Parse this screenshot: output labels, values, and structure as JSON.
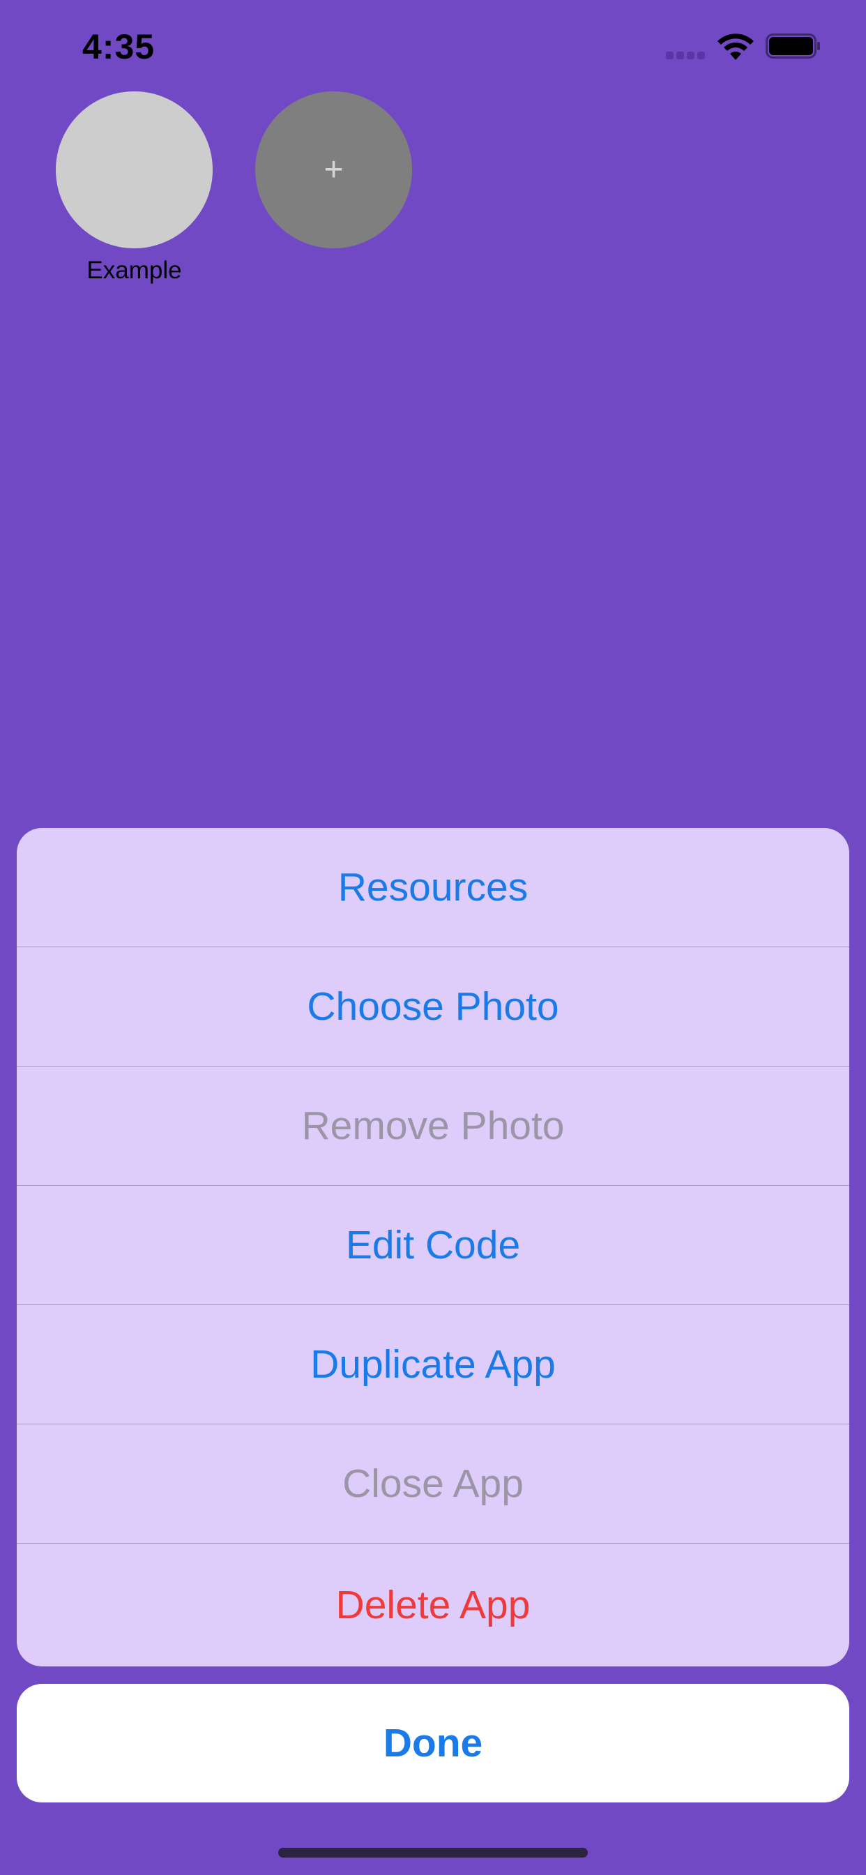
{
  "status_bar": {
    "time": "4:35",
    "icons": [
      "cellular-signal-icon",
      "wifi-icon",
      "battery-icon"
    ]
  },
  "apps": [
    {
      "label": "Example",
      "icon": "app-placeholder",
      "color": "#cdcdcd"
    },
    {
      "label": "+",
      "icon": "plus-icon",
      "color": "#7f7f7f"
    }
  ],
  "action_sheet": {
    "items": [
      {
        "label": "Resources",
        "state": "enabled"
      },
      {
        "label": "Choose Photo",
        "state": "enabled"
      },
      {
        "label": "Remove Photo",
        "state": "disabled"
      },
      {
        "label": "Edit Code",
        "state": "enabled"
      },
      {
        "label": "Duplicate App",
        "state": "enabled"
      },
      {
        "label": "Close App",
        "state": "disabled"
      },
      {
        "label": "Delete App",
        "state": "destructive"
      }
    ],
    "cancel_label": "Done"
  },
  "colors": {
    "background": "#7249c5",
    "sheet_background": "#decdfb",
    "action_blue": "#1a7ae8",
    "disabled_gray": "#9b95a6",
    "destructive_red": "#ee3a3a"
  }
}
